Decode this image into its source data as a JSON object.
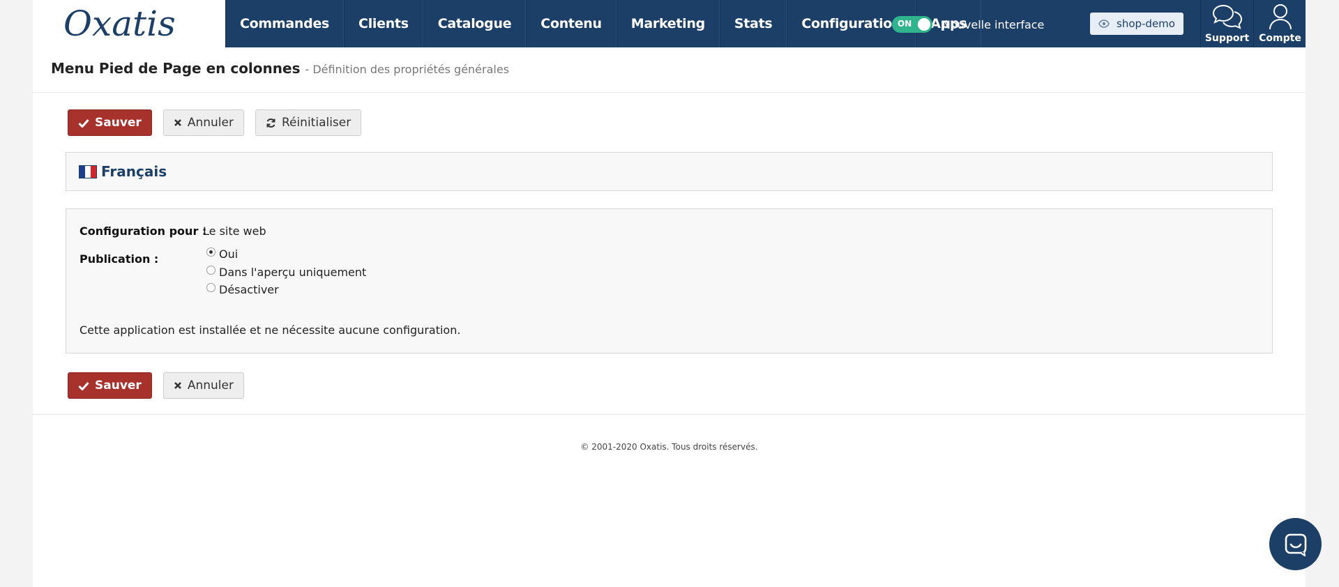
{
  "header": {
    "logo_text": "Oxatis",
    "nav": [
      "Commandes",
      "Clients",
      "Catalogue",
      "Contenu",
      "Marketing",
      "Stats",
      "Configuration",
      "Apps"
    ],
    "toggle": {
      "state": "ON",
      "label": "Nouvelle interface"
    },
    "shop": "shop-demo",
    "support_label": "Support",
    "account_label": "Compte"
  },
  "page": {
    "title": "Menu Pied de Page en colonnes",
    "subtitle": "- Définition des propriétés générales"
  },
  "actions": {
    "save": "Sauver",
    "cancel": "Annuler",
    "reset": "Réinitialiser"
  },
  "language": {
    "label": "Français"
  },
  "config": {
    "config_for_label": "Configuration pour :",
    "config_for_value": "Le site web",
    "publication_label": "Publication :",
    "publication_options": [
      {
        "label": "Oui",
        "checked": true
      },
      {
        "label": "Dans l'aperçu uniquement",
        "checked": false
      },
      {
        "label": "Désactiver",
        "checked": false
      }
    ],
    "note": "Cette application est installée et ne nécessite aucune configuration."
  },
  "footer": {
    "copyright": "© 2001-2020 Oxatis. Tous droits réservés."
  },
  "colors": {
    "nav_bg": "#1c3f68",
    "save_button": "#a7322c",
    "toggle_on": "#2fb48e"
  }
}
